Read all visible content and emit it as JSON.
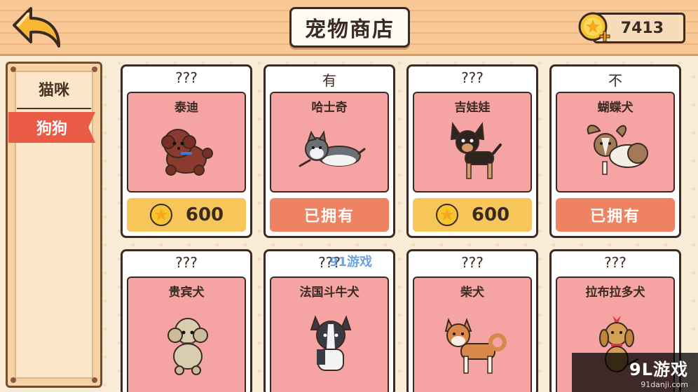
{
  "header": {
    "title": "宠物商店",
    "coins": "7413"
  },
  "sidebar": {
    "tabs": [
      {
        "label": "猫咪",
        "active": false
      },
      {
        "label": "狗狗",
        "active": true
      }
    ]
  },
  "cards": [
    {
      "status": "???",
      "name": "泰迪",
      "price": "600",
      "owned": false,
      "fur": "#8b3a2e"
    },
    {
      "status": "有",
      "name": "哈士奇",
      "price": "已拥有",
      "owned": true,
      "fur": "#6b6f78"
    },
    {
      "status": "???",
      "name": "吉娃娃",
      "price": "600",
      "owned": false,
      "fur": "#2d2420"
    },
    {
      "status": "不",
      "name": "蝴蝶犬",
      "price": "已拥有",
      "owned": true,
      "fur": "#a27a58"
    },
    {
      "status": "???",
      "name": "贵宾犬",
      "price": "",
      "owned": false,
      "fur": "#d9cdb0"
    },
    {
      "status": "???",
      "name": "法国斗牛犬",
      "price": "",
      "owned": false,
      "fur": "#3a3a44"
    },
    {
      "status": "???",
      "name": "柴犬",
      "price": "",
      "owned": false,
      "fur": "#d8894a"
    },
    {
      "status": "???",
      "name": "拉布拉多犬",
      "price": "",
      "owned": false,
      "fur": "#d79e55"
    }
  ],
  "watermark": {
    "center": "91游戏",
    "corner": "9L游戏",
    "corner_url": "91danji.com"
  },
  "colors": {
    "accent_red": "#e95b45",
    "card_pink": "#f5a3a3",
    "price_yellow": "#f6c65a",
    "owned_orange": "#ef8262"
  }
}
